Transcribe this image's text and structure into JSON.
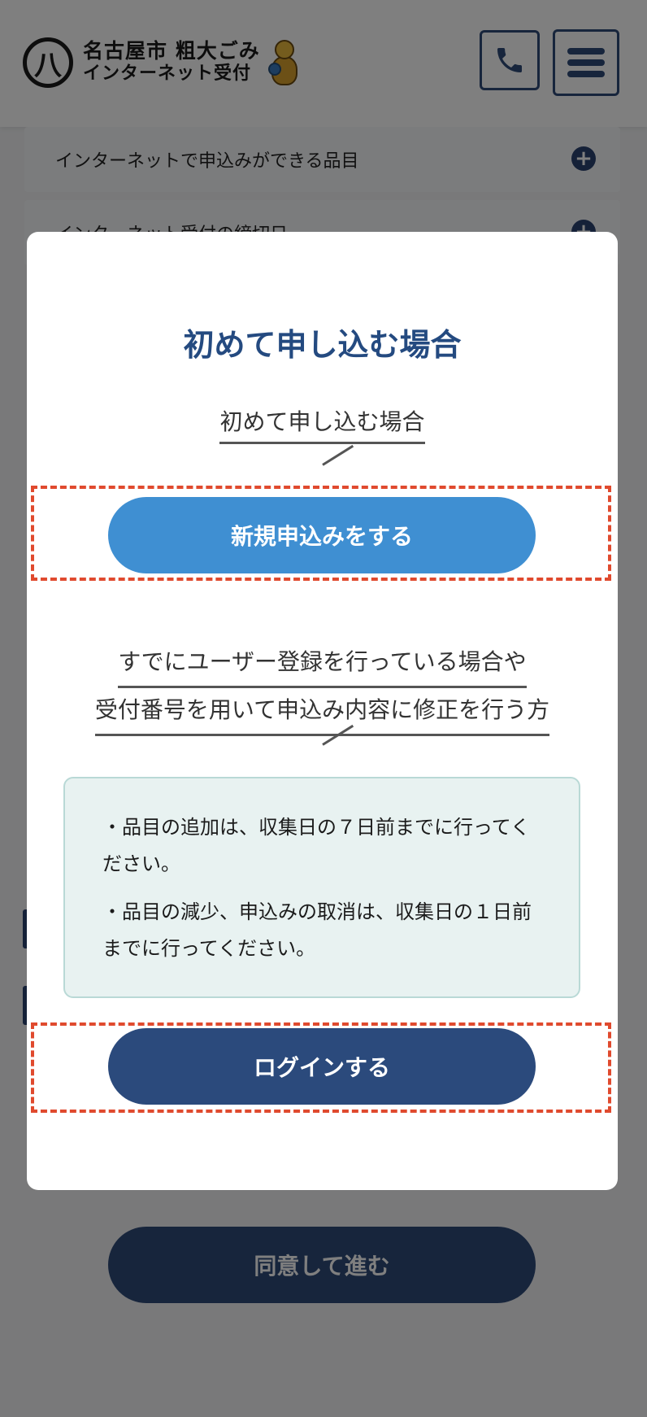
{
  "header": {
    "logo_mark": "八",
    "logo_line1": "名古屋市 粗大ごみ",
    "logo_line2": "インターネット受付",
    "tel_icon": "phone-icon",
    "menu_icon": "hamburger-menu-icon"
  },
  "accordion": {
    "items": [
      {
        "label": "インターネットで申込みができる品目"
      },
      {
        "label": "インターネット受付の締切日"
      }
    ]
  },
  "agree_button_label": "同意して進む",
  "modal": {
    "title": "初めて申し込む場合",
    "new_section_caption": "初めて申し込む場合",
    "new_button_label": "新規申込みをする",
    "existing_caption_line1": "すでにユーザー登録を行っている場合や",
    "existing_caption_line2": "受付番号を用いて申込み内容に修正を行う方",
    "notice": {
      "item1": "・品目の追加は、収集日の７日前までに行ってください。",
      "item2": "・品目の減少、申込みの取消は、収集日の１日前までに行ってください。"
    },
    "login_button_label": "ログインする"
  },
  "colors": {
    "primary_navy": "#2b4a7c",
    "accent_blue": "#3f8fd2",
    "highlight_dash": "#e04a2e",
    "notice_bg": "#e8f2f1"
  }
}
